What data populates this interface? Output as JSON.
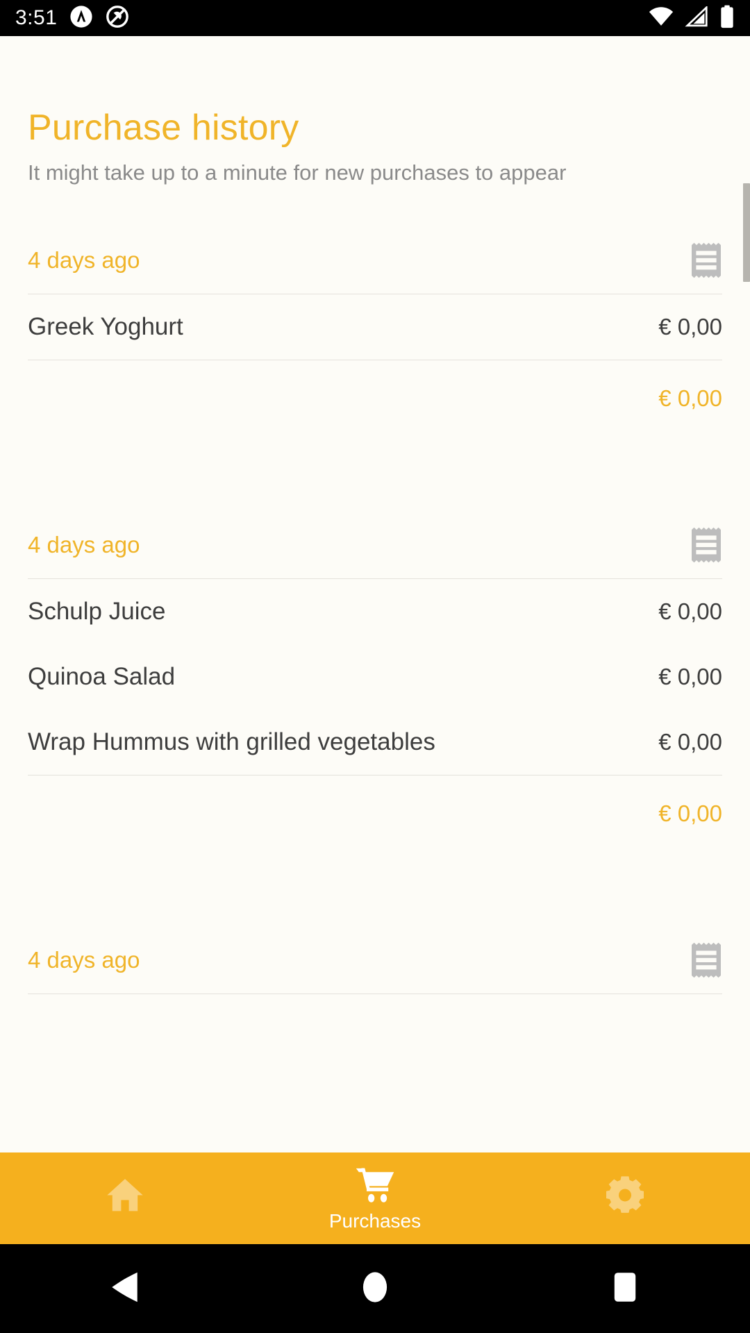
{
  "status_bar": {
    "clock": "3:51",
    "left_icons": [
      "assistant-icon",
      "do-not-disturb-icon"
    ],
    "right_icons": [
      "wifi-icon",
      "cellular-signal-icon",
      "battery-icon"
    ]
  },
  "header": {
    "title": "Purchase history",
    "subtitle": "It might take up to a minute for new purchases to appear"
  },
  "colors": {
    "accent": "#F0B429",
    "tabbar": "#F5B01E",
    "background": "#FDFCF7",
    "text": "#3D3D3D",
    "muted": "#8A8A8A",
    "divider": "#E4E2DC",
    "receipt_icon": "#BDBDBD"
  },
  "groups": [
    {
      "date": "4 days ago",
      "receipt_icon": "receipt-icon",
      "items": [
        {
          "name": "Greek Yoghurt",
          "price": "€ 0,00"
        }
      ],
      "total": "€ 0,00"
    },
    {
      "date": "4 days ago",
      "receipt_icon": "receipt-icon",
      "items": [
        {
          "name": "Schulp Juice",
          "price": "€ 0,00"
        },
        {
          "name": "Quinoa Salad",
          "price": "€ 0,00"
        },
        {
          "name": "Wrap Hummus with grilled vegetables",
          "price": "€ 0,00"
        }
      ],
      "total": "€ 0,00"
    },
    {
      "date": "4 days ago",
      "receipt_icon": "receipt-icon",
      "items": [],
      "total": ""
    }
  ],
  "tabbar": {
    "tabs": [
      {
        "label": "",
        "icon": "home-icon",
        "active": false
      },
      {
        "label": "Purchases",
        "icon": "shopping-cart-icon",
        "active": true
      },
      {
        "label": "",
        "icon": "gear-icon",
        "active": false
      }
    ]
  },
  "nav_bar": {
    "back": "back-triangle-icon",
    "home": "home-circle-icon",
    "recents": "recents-square-icon"
  }
}
